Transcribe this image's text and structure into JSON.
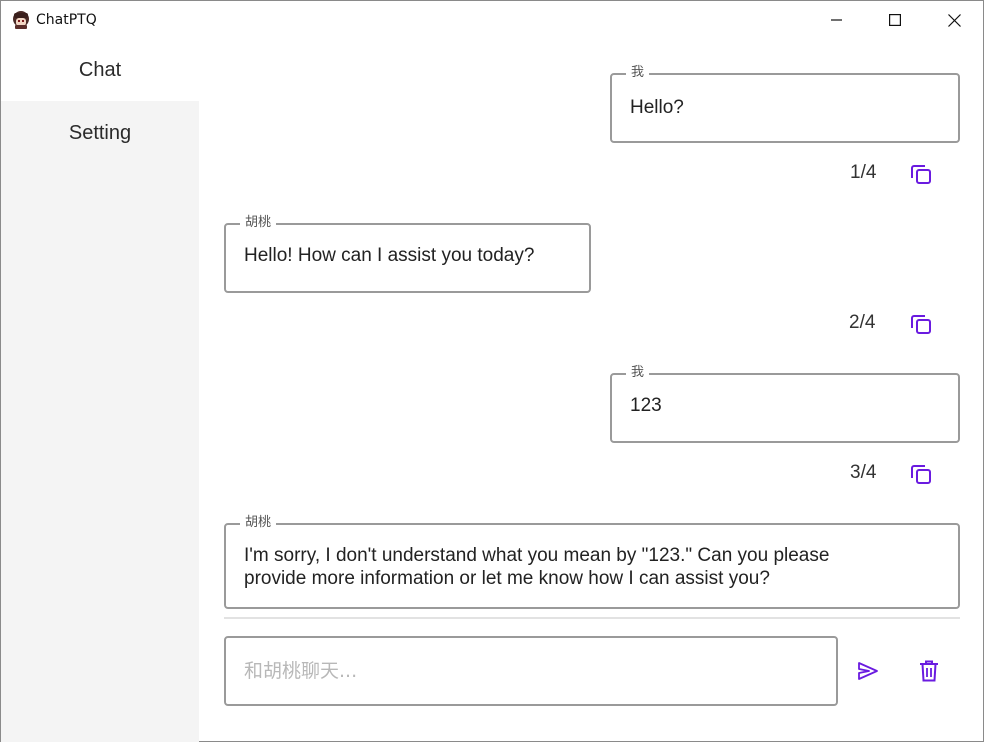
{
  "window": {
    "title": "ChatPTQ"
  },
  "sidebar": {
    "items": [
      {
        "label": "Chat",
        "selected": true
      },
      {
        "label": "Setting",
        "selected": false
      }
    ]
  },
  "messages": [
    {
      "sender": "我",
      "text": "Hello?",
      "counter": "1/4"
    },
    {
      "sender": "胡桃",
      "text": "Hello! How can I assist you today?",
      "counter": "2/4"
    },
    {
      "sender": "我",
      "text": "123",
      "counter": "3/4"
    },
    {
      "sender": "胡桃",
      "text_line1": "I'm sorry, I don't understand what you mean by \"123.\" Can you please",
      "text_line2": "provide more information or let me know how I can assist you?"
    }
  ],
  "composer": {
    "placeholder": "和胡桃聊天...",
    "value": ""
  },
  "colors": {
    "accent": "#6a1be0",
    "sidebar_bg": "#f4f4f4",
    "border": "#9a9a9a"
  },
  "icons": {
    "app": "app-avatar-icon",
    "copy": "copy-icon",
    "send": "send-icon",
    "delete": "trash-icon",
    "minimize": "minimize-icon",
    "maximize": "maximize-icon",
    "close": "close-icon"
  }
}
